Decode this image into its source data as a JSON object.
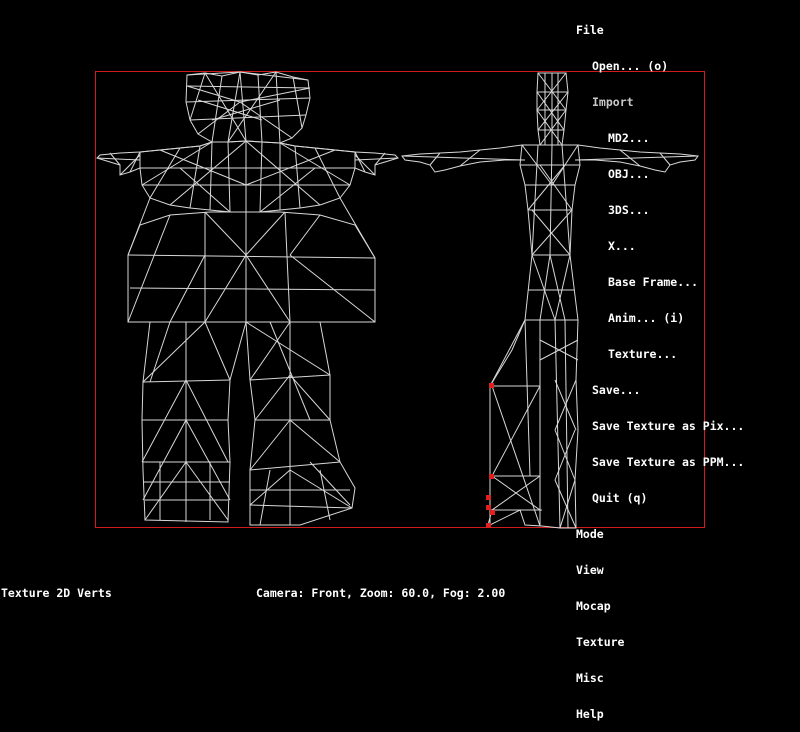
{
  "colors": {
    "background": "#000000",
    "wire": "#d8d8d8",
    "frame": "#d01c1c",
    "vertex": "#e02020",
    "text": "#ffffff"
  },
  "menu": {
    "file": "File",
    "open": "Open... (o)",
    "import": "Import",
    "md2": "MD2...",
    "obj": "OBJ...",
    "3ds": "3DS...",
    "x": "X...",
    "base_frame": "Base Frame...",
    "anim": "Anim... (i)",
    "texture_import": "Texture...",
    "save": "Save...",
    "save_tex_pix": "Save Texture as Pix...",
    "save_tex_ppm": "Save Texture as PPM...",
    "quit": "Quit (q)",
    "mode": "Mode",
    "view": "View",
    "mocap": "Mocap",
    "texture": "Texture",
    "misc": "Misc",
    "help": "Help"
  },
  "status": {
    "mode": "Texture 2D Verts",
    "camera": "Camera: Front, Zoom: 60.0, Fog: 2.00"
  }
}
